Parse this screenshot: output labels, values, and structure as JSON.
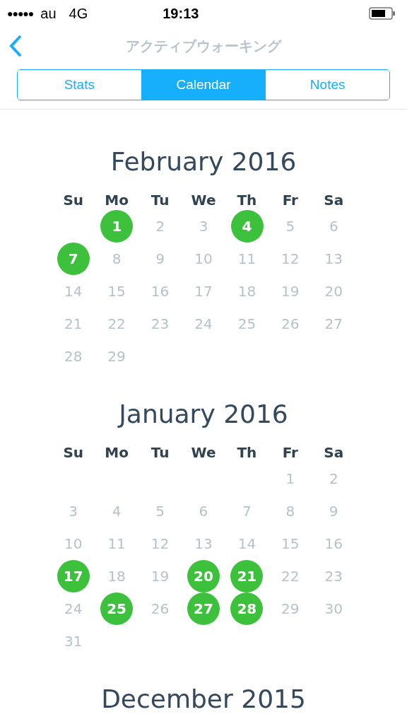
{
  "status_bar": {
    "signal": "●●●●●",
    "carrier": "au",
    "network": "4G",
    "time": "19:13"
  },
  "nav": {
    "title": "アクティブウォーキング"
  },
  "tabs": [
    {
      "label": "Stats",
      "selected": false
    },
    {
      "label": "Calendar",
      "selected": true
    },
    {
      "label": "Notes",
      "selected": false
    }
  ],
  "months": [
    {
      "title": "February 2016",
      "weekdays": [
        "Su",
        "Mo",
        "Tu",
        "We",
        "Th",
        "Fr",
        "Sa"
      ],
      "weeks": [
        {
          "kind": "leading",
          "days": [
            {
              "day": "1",
              "active": true
            },
            {
              "day": "2",
              "active": false
            },
            {
              "day": "3",
              "active": false
            },
            {
              "day": "4",
              "active": true
            },
            {
              "day": "5",
              "active": false
            },
            {
              "day": "6",
              "active": false
            }
          ]
        },
        {
          "kind": "full",
          "days": [
            {
              "day": "7",
              "active": true
            },
            {
              "day": "8",
              "active": false
            },
            {
              "day": "9",
              "active": false
            },
            {
              "day": "10",
              "active": false
            },
            {
              "day": "11",
              "active": false
            },
            {
              "day": "12",
              "active": false
            },
            {
              "day": "13",
              "active": false
            }
          ]
        },
        {
          "kind": "full",
          "days": [
            {
              "day": "14",
              "active": false
            },
            {
              "day": "15",
              "active": false
            },
            {
              "day": "16",
              "active": false
            },
            {
              "day": "17",
              "active": false
            },
            {
              "day": "18",
              "active": false
            },
            {
              "day": "19",
              "active": false
            },
            {
              "day": "20",
              "active": false
            }
          ]
        },
        {
          "kind": "full",
          "days": [
            {
              "day": "21",
              "active": false
            },
            {
              "day": "22",
              "active": false
            },
            {
              "day": "23",
              "active": false
            },
            {
              "day": "24",
              "active": false
            },
            {
              "day": "25",
              "active": false
            },
            {
              "day": "26",
              "active": false
            },
            {
              "day": "27",
              "active": false
            }
          ]
        },
        {
          "kind": "trailing",
          "days": [
            {
              "day": "28",
              "active": false
            },
            {
              "day": "29",
              "active": false
            }
          ]
        }
      ]
    },
    {
      "title": "January 2016",
      "weekdays": [
        "Su",
        "Mo",
        "Tu",
        "We",
        "Th",
        "Fr",
        "Sa"
      ],
      "weeks": [
        {
          "kind": "leading",
          "days": [
            {
              "day": "1",
              "active": false
            },
            {
              "day": "2",
              "active": false
            }
          ]
        },
        {
          "kind": "full",
          "days": [
            {
              "day": "3",
              "active": false
            },
            {
              "day": "4",
              "active": false
            },
            {
              "day": "5",
              "active": false
            },
            {
              "day": "6",
              "active": false
            },
            {
              "day": "7",
              "active": false
            },
            {
              "day": "8",
              "active": false
            },
            {
              "day": "9",
              "active": false
            }
          ]
        },
        {
          "kind": "full",
          "days": [
            {
              "day": "10",
              "active": false
            },
            {
              "day": "11",
              "active": false
            },
            {
              "day": "12",
              "active": false
            },
            {
              "day": "13",
              "active": false
            },
            {
              "day": "14",
              "active": false
            },
            {
              "day": "15",
              "active": false
            },
            {
              "day": "16",
              "active": false
            }
          ]
        },
        {
          "kind": "full",
          "days": [
            {
              "day": "17",
              "active": true
            },
            {
              "day": "18",
              "active": false
            },
            {
              "day": "19",
              "active": false
            },
            {
              "day": "20",
              "active": true
            },
            {
              "day": "21",
              "active": true
            },
            {
              "day": "22",
              "active": false
            },
            {
              "day": "23",
              "active": false
            }
          ]
        },
        {
          "kind": "full",
          "days": [
            {
              "day": "24",
              "active": false
            },
            {
              "day": "25",
              "active": true
            },
            {
              "day": "26",
              "active": false
            },
            {
              "day": "27",
              "active": true
            },
            {
              "day": "28",
              "active": true
            },
            {
              "day": "29",
              "active": false
            },
            {
              "day": "30",
              "active": false
            }
          ]
        },
        {
          "kind": "trailing",
          "days": [
            {
              "day": "31",
              "active": false
            }
          ]
        }
      ]
    },
    {
      "title": "December 2015"
    }
  ]
}
